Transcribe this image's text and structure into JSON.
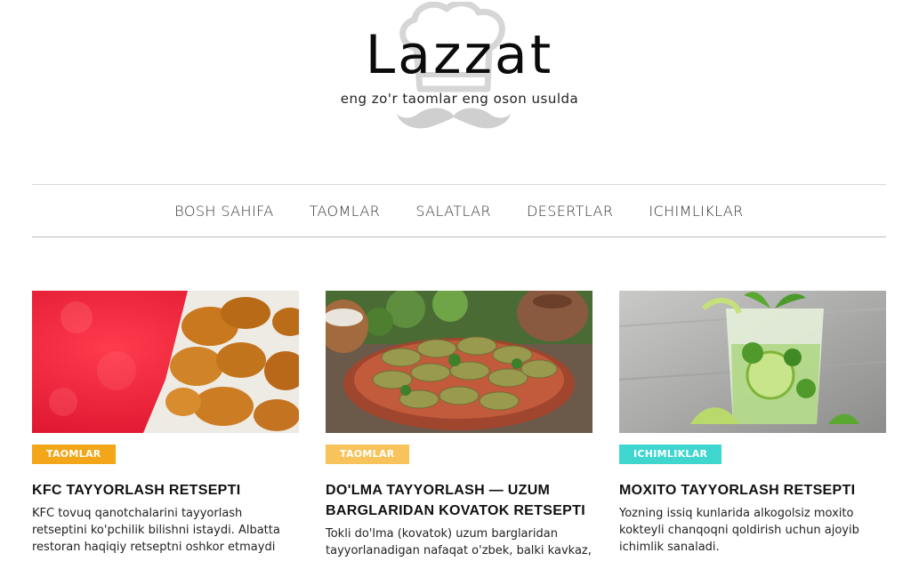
{
  "site": {
    "title": "Lazzat",
    "tagline": "eng zo'r taomlar eng oson usulda"
  },
  "nav": {
    "items": [
      "BOSH SAHIFA",
      "TAOMLAR",
      "SALATLAR",
      "DESERTLAR",
      "ICHIMLIKLAR"
    ]
  },
  "colors": {
    "badge_taomlar_1": "#f2a618",
    "badge_taomlar_2": "#f8c35a",
    "badge_ichimliklar": "#3fd6cf"
  },
  "cards": [
    {
      "category": "TAOMLAR",
      "title": "KFC TAYYORLASH RETSEPTI",
      "excerpt": "KFC tovuq qanotchalarini tayyorlash retseptini ko'pchilik bilishni istaydi. Albatta restoran haqiqiy retseptni oshkor etmaydi",
      "image": "fried-chicken-photo"
    },
    {
      "category": "TAOMLAR",
      "title": "DO'LMA TAYYORLASH — UZUM BARGLARIDAN KOVATOK RETSEPTI",
      "excerpt": "Tokli do'lma (kovatok) uzum barglaridan tayyorlanadigan nafaqat o'zbek, balki kavkaz,",
      "image": "dolma-photo"
    },
    {
      "category": "ICHIMLIKLAR",
      "title": "MOXITO TAYYORLASH RETSEPTI",
      "excerpt": "Yozning issiq kunlarida alkogolsiz moxito kokteyli chanqoqni qoldirish uchun ajoyib ichimlik sanaladi.",
      "image": "mojito-photo"
    }
  ]
}
